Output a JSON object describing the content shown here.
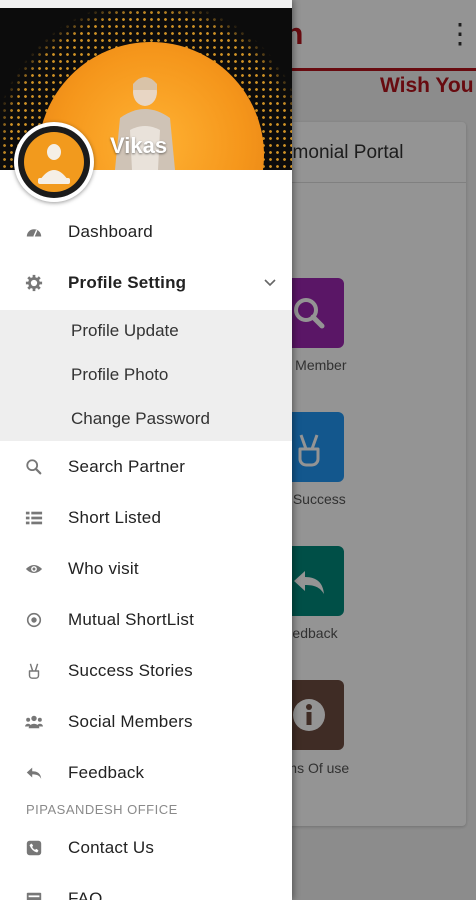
{
  "background": {
    "app_title": "esh",
    "marquee": "Wish You",
    "card_title": "rimonial Portal",
    "tiles": [
      {
        "label": "d Member",
        "color": "#9c27b0",
        "icon": "search-icon"
      },
      {
        "label": "r Success",
        "color": "#2196f3",
        "icon": "peace-hand-icon"
      },
      {
        "label": "edback",
        "color": "#00897b",
        "icon": "reply-icon"
      },
      {
        "label": "rms Of use",
        "color": "#6d4c41",
        "icon": "info-icon"
      }
    ]
  },
  "drawer": {
    "user_name": "Vikas",
    "menu": [
      {
        "label": "Dashboard",
        "icon": "dashboard-icon"
      },
      {
        "label": "Profile Setting",
        "icon": "gear-icon",
        "expanded": true
      }
    ],
    "submenu": [
      {
        "label": "Profile Update"
      },
      {
        "label": "Profile Photo"
      },
      {
        "label": "Change Password"
      }
    ],
    "menu2": [
      {
        "label": "Search Partner",
        "icon": "search-icon"
      },
      {
        "label": "Short Listed",
        "icon": "list-icon"
      },
      {
        "label": "Who visit",
        "icon": "eye-icon"
      },
      {
        "label": "Mutual ShortList",
        "icon": "radio-dot-icon"
      },
      {
        "label": "Success Stories",
        "icon": "peace-hand-icon"
      },
      {
        "label": "Social Members",
        "icon": "users-icon"
      },
      {
        "label": "Feedback",
        "icon": "reply-icon"
      }
    ],
    "section_label": "PIPASANDESH OFFICE",
    "menu3": [
      {
        "label": "Contact Us",
        "icon": "phone-icon"
      },
      {
        "label": "FAQ",
        "icon": "faq-icon"
      }
    ]
  },
  "colors": {
    "brand_red": "#b3141c",
    "accent_orange": "#f29a1d"
  }
}
